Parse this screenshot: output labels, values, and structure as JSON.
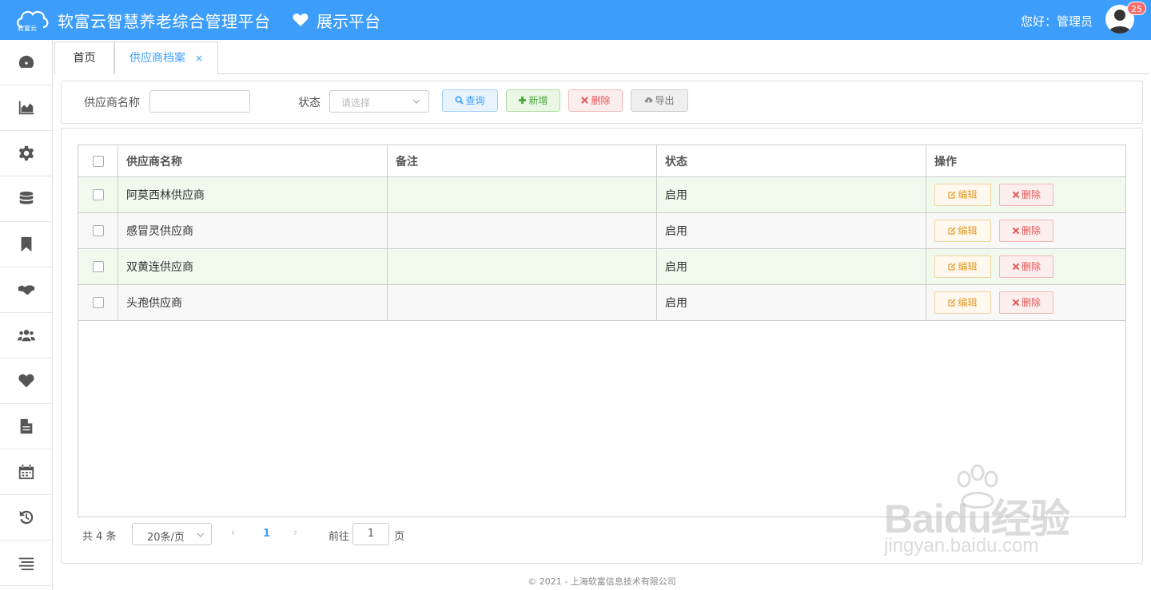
{
  "header": {
    "app_title": "软富云智慧养老综合管理平台",
    "sub_title": "展示平台",
    "logo_text": "软富云",
    "greeting": "您好：管理员",
    "notification_count": "25",
    "brand_color": "#3d9dfb"
  },
  "sidebar": {
    "items": [
      {
        "icon": "dashboard-icon"
      },
      {
        "icon": "area-chart-icon"
      },
      {
        "icon": "gear-icon"
      },
      {
        "icon": "database-icon"
      },
      {
        "icon": "bookmark-icon"
      },
      {
        "icon": "handshake-icon"
      },
      {
        "icon": "users-icon"
      },
      {
        "icon": "heart-icon"
      },
      {
        "icon": "document-icon"
      },
      {
        "icon": "calendar-icon"
      },
      {
        "icon": "history-icon"
      },
      {
        "icon": "menu-icon"
      }
    ]
  },
  "tabs": {
    "home": "首页",
    "supplier": "供应商档案",
    "close": "×"
  },
  "filter": {
    "name_label": "供应商名称",
    "name_value": "",
    "status_label": "状态",
    "status_placeholder": "请选择",
    "search_label": "查询",
    "add_label": "新增",
    "delete_label": "删除",
    "export_label": "导出"
  },
  "table": {
    "columns": [
      "供应商名称",
      "备注",
      "状态",
      "操作"
    ],
    "rows": [
      {
        "name": "阿莫西林供应商",
        "remark": "",
        "status": "启用"
      },
      {
        "name": "感冒灵供应商",
        "remark": "",
        "status": "启用"
      },
      {
        "name": "双黄连供应商",
        "remark": "",
        "status": "启用"
      },
      {
        "name": "头孢供应商",
        "remark": "",
        "status": "启用"
      }
    ],
    "edit_label": "编辑",
    "delete_label": "删除"
  },
  "pagination": {
    "total": "共 4 条",
    "page_size": "20条/页",
    "current_page": "1",
    "goto_label": "前往",
    "goto_value": "1",
    "goto_suffix": "页",
    "prev": "‹",
    "next": "›"
  },
  "footer": {
    "copyright": "© 2021 - 上海软富信息技术有限公司"
  },
  "watermark": {
    "text": "Baidu经验",
    "url": "jingyan.baidu.com"
  }
}
